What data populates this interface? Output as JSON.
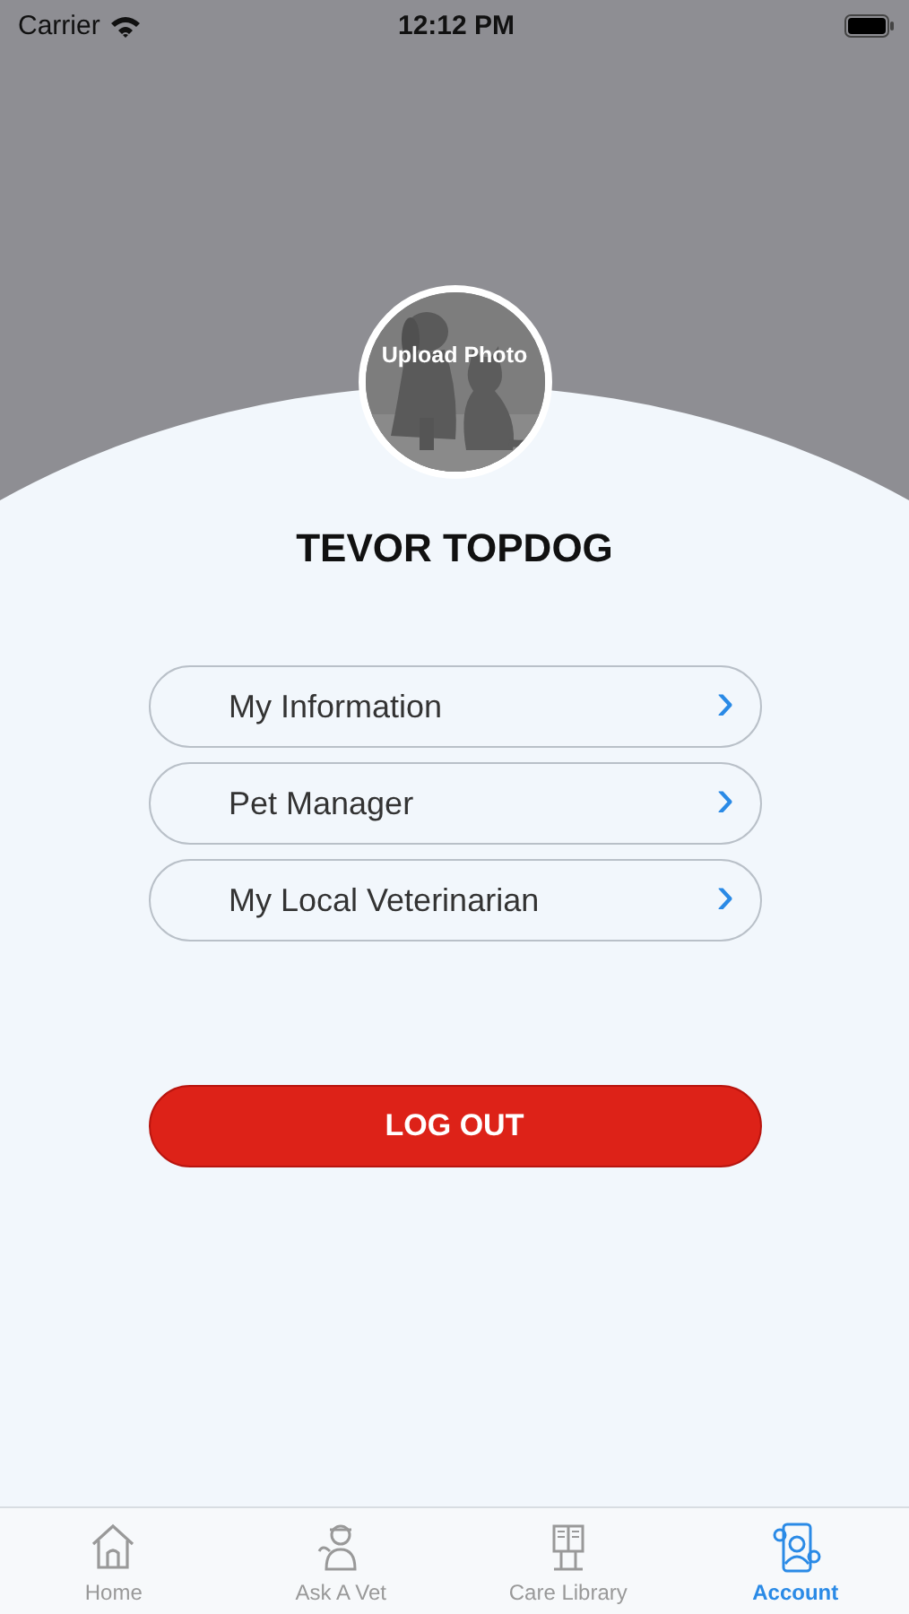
{
  "status_bar": {
    "carrier": "Carrier",
    "time": "12:12 PM"
  },
  "profile": {
    "photo_label": "Upload Photo",
    "name": "TEVOR TOPDOG"
  },
  "menu": [
    {
      "label": "My Information",
      "chevron": "›"
    },
    {
      "label": "Pet Manager",
      "chevron": "›"
    },
    {
      "label": "My Local Veterinarian",
      "chevron": "›"
    }
  ],
  "logout_button": "LOG OUT",
  "tabs": [
    {
      "label": "Home",
      "kind": "home",
      "selected": false
    },
    {
      "label": "Ask A Vet",
      "kind": "vet",
      "selected": false
    },
    {
      "label": "Care Library",
      "kind": "library",
      "selected": false
    },
    {
      "label": "Account",
      "kind": "account",
      "selected": true
    }
  ]
}
